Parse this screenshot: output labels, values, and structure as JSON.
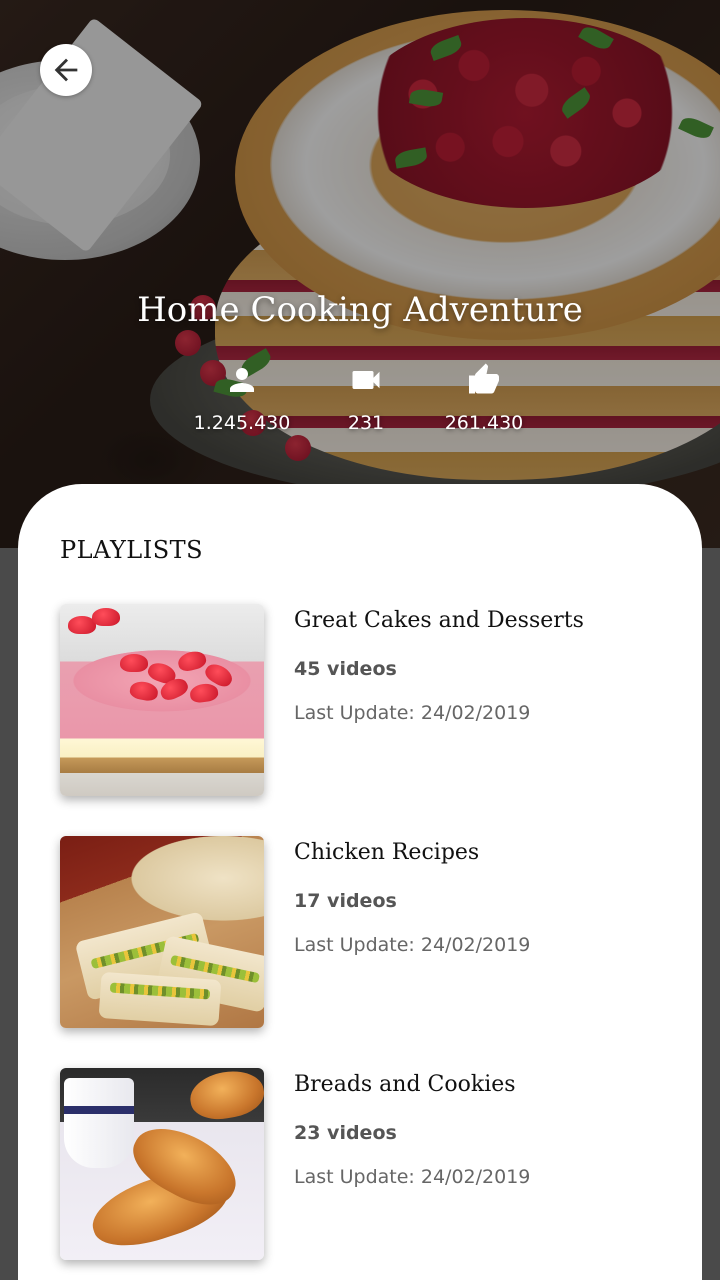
{
  "header": {
    "back_icon": "arrow-back-icon",
    "title": "Home Cooking Adventure",
    "stats": {
      "subscribers": "1.245.430",
      "videos": "231",
      "likes": "261.430"
    },
    "icons": {
      "subscribers": "person-icon",
      "videos": "video-camera-icon",
      "likes": "thumbs-up-icon"
    }
  },
  "playlists": {
    "section_title": "PLAYLISTS",
    "items": [
      {
        "title": "Great Cakes and Desserts",
        "count": "45 videos",
        "updated": "Last Update: 24/02/2019"
      },
      {
        "title": "Chicken Recipes",
        "count": "17 videos",
        "updated": "Last Update: 24/02/2019"
      },
      {
        "title": "Breads and Cookies",
        "count": "23 videos",
        "updated": "Last Update: 24/02/2019"
      }
    ]
  },
  "colors": {
    "card_bg": "#ffffff",
    "title_text": "#111111",
    "meta_text": "#666666",
    "hero_text": "#ffffff"
  }
}
